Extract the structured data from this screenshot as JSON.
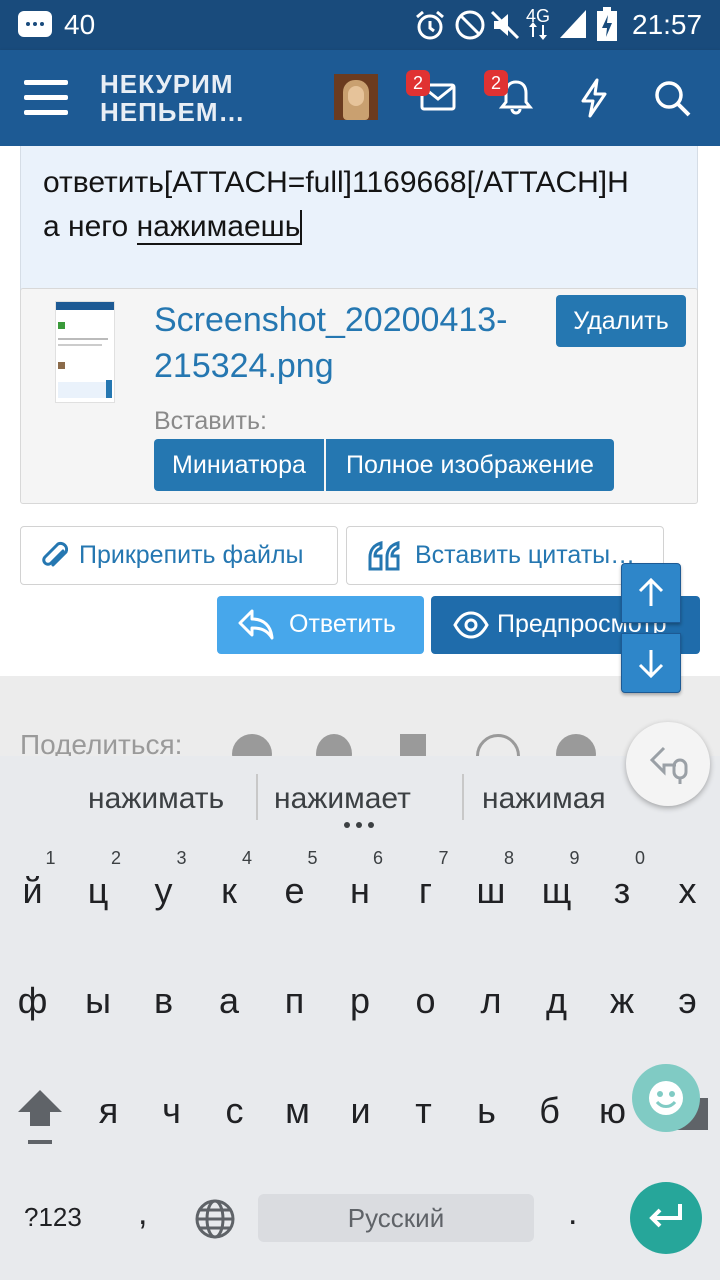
{
  "status_bar": {
    "notification_count": "40",
    "network": "4G",
    "time": "21:57"
  },
  "header": {
    "logo_line1": "НЕКУРИМ",
    "logo_line2": "НЕПЬЕМ…",
    "messages_badge": "2",
    "alerts_badge": "2"
  },
  "editor": {
    "line1": "ответить[ATTACH=full]1169668[/ATTACH]Н",
    "line2_prefix": "а него ",
    "line2_word": "нажимаешь"
  },
  "attachment": {
    "filename_line1": "Screenshot_20200413-",
    "filename_line2": "215324.png",
    "delete_label": "Удалить",
    "insert_label": "Вставить:",
    "thumbnail_label": "Миниатюра",
    "full_image_label": "Полное изображение"
  },
  "actions": {
    "attach_files_label": "Прикрепить файлы",
    "insert_quotes_label": "Вставить цитаты…",
    "reply_label": "Ответить",
    "preview_label": "Предпросмотр"
  },
  "share": {
    "label": "Поделиться:"
  },
  "keyboard": {
    "suggestions": [
      "нажимать",
      "нажимает",
      "нажимая"
    ],
    "row1": [
      "й",
      "ц",
      "у",
      "к",
      "е",
      "н",
      "г",
      "ш",
      "щ",
      "з",
      "х"
    ],
    "row1_hints": [
      "1",
      "2",
      "3",
      "4",
      "5",
      "6",
      "7",
      "8",
      "9",
      "0"
    ],
    "row2": [
      "ф",
      "ы",
      "в",
      "а",
      "п",
      "р",
      "о",
      "л",
      "д",
      "ж",
      "э"
    ],
    "row3": [
      "я",
      "ч",
      "с",
      "м",
      "и",
      "т",
      "ь",
      "б",
      "ю"
    ],
    "symbols_label": "?123",
    "comma": ",",
    "space_label": "Русский",
    "period": "."
  },
  "colors": {
    "brand": "#1d5a94",
    "accent": "#2577b1",
    "keyboard_action": "#26a69a"
  }
}
